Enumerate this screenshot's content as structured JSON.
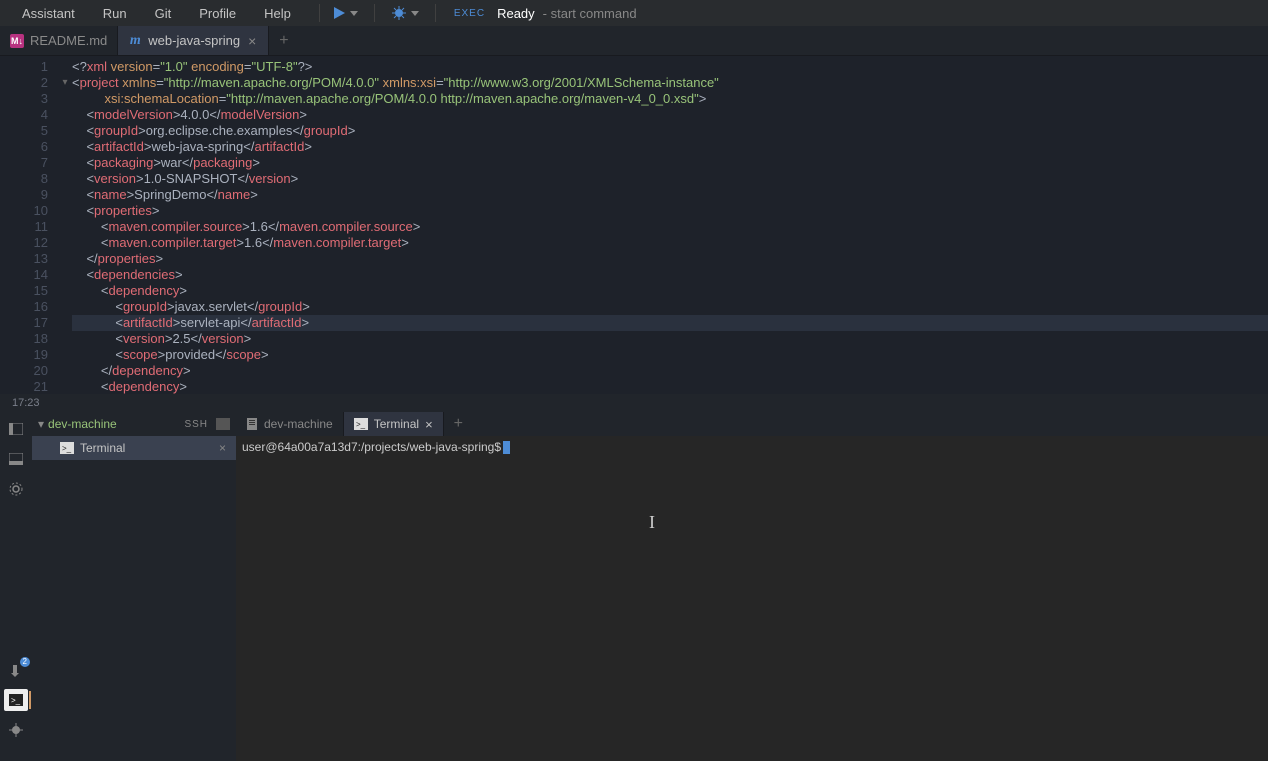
{
  "menu": {
    "items": [
      "Assistant",
      "Run",
      "Git",
      "Profile",
      "Help"
    ]
  },
  "toolbar": {
    "exec": "EXEC",
    "ready": "Ready",
    "hint": "- start command"
  },
  "editorTabs": [
    {
      "icon": "md",
      "label": "README.md",
      "active": false,
      "closable": false
    },
    {
      "icon": "mvn",
      "label": "web-java-spring",
      "active": true,
      "closable": true
    }
  ],
  "code": {
    "lines": [
      {
        "n": 1,
        "indent": 0,
        "tokens": [
          [
            "pi",
            "<?"
          ],
          [
            "tag",
            "xml"
          ],
          [
            "txt",
            " "
          ],
          [
            "attr",
            "version"
          ],
          [
            "punc",
            "="
          ],
          [
            "str",
            "\"1.0\""
          ],
          [
            "txt",
            " "
          ],
          [
            "attr",
            "encoding"
          ],
          [
            "punc",
            "="
          ],
          [
            "str",
            "\"UTF-8\""
          ],
          [
            "pi",
            "?>"
          ]
        ]
      },
      {
        "n": 2,
        "indent": 0,
        "fold": "▾",
        "tokens": [
          [
            "punc",
            "<"
          ],
          [
            "tag",
            "project"
          ],
          [
            "txt",
            " "
          ],
          [
            "attr",
            "xmlns"
          ],
          [
            "punc",
            "="
          ],
          [
            "str",
            "\"http://maven.apache.org/POM/4.0.0\""
          ],
          [
            "txt",
            " "
          ],
          [
            "attr",
            "xmlns:xsi"
          ],
          [
            "punc",
            "="
          ],
          [
            "str",
            "\"http://www.w3.org/2001/XMLSchema-instance\""
          ]
        ]
      },
      {
        "n": 3,
        "indent": 9,
        "tokens": [
          [
            "attr",
            "xsi:schemaLocation"
          ],
          [
            "punc",
            "="
          ],
          [
            "str",
            "\"http://maven.apache.org/POM/4.0.0 http://maven.apache.org/maven-v4_0_0.xsd\""
          ],
          [
            "punc",
            ">"
          ]
        ]
      },
      {
        "n": 4,
        "indent": 4,
        "tokens": [
          [
            "punc",
            "<"
          ],
          [
            "tag",
            "modelVersion"
          ],
          [
            "punc",
            ">"
          ],
          [
            "txt",
            "4.0.0"
          ],
          [
            "punc",
            "</"
          ],
          [
            "tag",
            "modelVersion"
          ],
          [
            "punc",
            ">"
          ]
        ]
      },
      {
        "n": 5,
        "indent": 4,
        "tokens": [
          [
            "punc",
            "<"
          ],
          [
            "tag",
            "groupId"
          ],
          [
            "punc",
            ">"
          ],
          [
            "txt",
            "org.eclipse.che.examples"
          ],
          [
            "punc",
            "</"
          ],
          [
            "tag",
            "groupId"
          ],
          [
            "punc",
            ">"
          ]
        ]
      },
      {
        "n": 6,
        "indent": 4,
        "tokens": [
          [
            "punc",
            "<"
          ],
          [
            "tag",
            "artifactId"
          ],
          [
            "punc",
            ">"
          ],
          [
            "txt",
            "web-java-spring"
          ],
          [
            "punc",
            "</"
          ],
          [
            "tag",
            "artifactId"
          ],
          [
            "punc",
            ">"
          ]
        ]
      },
      {
        "n": 7,
        "indent": 4,
        "tokens": [
          [
            "punc",
            "<"
          ],
          [
            "tag",
            "packaging"
          ],
          [
            "punc",
            ">"
          ],
          [
            "txt",
            "war"
          ],
          [
            "punc",
            "</"
          ],
          [
            "tag",
            "packaging"
          ],
          [
            "punc",
            ">"
          ]
        ]
      },
      {
        "n": 8,
        "indent": 4,
        "tokens": [
          [
            "punc",
            "<"
          ],
          [
            "tag",
            "version"
          ],
          [
            "punc",
            ">"
          ],
          [
            "txt",
            "1.0-SNAPSHOT"
          ],
          [
            "punc",
            "</"
          ],
          [
            "tag",
            "version"
          ],
          [
            "punc",
            ">"
          ]
        ]
      },
      {
        "n": 9,
        "indent": 4,
        "tokens": [
          [
            "punc",
            "<"
          ],
          [
            "tag",
            "name"
          ],
          [
            "punc",
            ">"
          ],
          [
            "txt",
            "SpringDemo"
          ],
          [
            "punc",
            "</"
          ],
          [
            "tag",
            "name"
          ],
          [
            "punc",
            ">"
          ]
        ]
      },
      {
        "n": 10,
        "indent": 4,
        "tokens": [
          [
            "punc",
            "<"
          ],
          [
            "tag",
            "properties"
          ],
          [
            "punc",
            ">"
          ]
        ]
      },
      {
        "n": 11,
        "indent": 8,
        "tokens": [
          [
            "punc",
            "<"
          ],
          [
            "tag",
            "maven.compiler.source"
          ],
          [
            "punc",
            ">"
          ],
          [
            "txt",
            "1.6"
          ],
          [
            "punc",
            "</"
          ],
          [
            "tag",
            "maven.compiler.source"
          ],
          [
            "punc",
            ">"
          ]
        ]
      },
      {
        "n": 12,
        "indent": 8,
        "tokens": [
          [
            "punc",
            "<"
          ],
          [
            "tag",
            "maven.compiler.target"
          ],
          [
            "punc",
            ">"
          ],
          [
            "txt",
            "1.6"
          ],
          [
            "punc",
            "</"
          ],
          [
            "tag",
            "maven.compiler.target"
          ],
          [
            "punc",
            ">"
          ]
        ]
      },
      {
        "n": 13,
        "indent": 4,
        "tokens": [
          [
            "punc",
            "</"
          ],
          [
            "tag",
            "properties"
          ],
          [
            "punc",
            ">"
          ]
        ]
      },
      {
        "n": 14,
        "indent": 4,
        "tokens": [
          [
            "punc",
            "<"
          ],
          [
            "tag",
            "dependencies"
          ],
          [
            "punc",
            ">"
          ]
        ]
      },
      {
        "n": 15,
        "indent": 8,
        "tokens": [
          [
            "punc",
            "<"
          ],
          [
            "tag",
            "dependency"
          ],
          [
            "punc",
            ">"
          ]
        ]
      },
      {
        "n": 16,
        "indent": 12,
        "tokens": [
          [
            "punc",
            "<"
          ],
          [
            "tag",
            "groupId"
          ],
          [
            "punc",
            ">"
          ],
          [
            "txt",
            "javax.servlet"
          ],
          [
            "punc",
            "</"
          ],
          [
            "tag",
            "groupId"
          ],
          [
            "punc",
            ">"
          ]
        ]
      },
      {
        "n": 17,
        "indent": 12,
        "hl": true,
        "tokens": [
          [
            "punc",
            "<"
          ],
          [
            "tag",
            "artifactId"
          ],
          [
            "punc",
            ">"
          ],
          [
            "txt",
            "servlet-api"
          ],
          [
            "punc",
            "</"
          ],
          [
            "tag",
            "artifactId"
          ],
          [
            "punc",
            ">"
          ]
        ]
      },
      {
        "n": 18,
        "indent": 12,
        "tokens": [
          [
            "punc",
            "<"
          ],
          [
            "tag",
            "version"
          ],
          [
            "punc",
            ">"
          ],
          [
            "txt",
            "2.5"
          ],
          [
            "punc",
            "</"
          ],
          [
            "tag",
            "version"
          ],
          [
            "punc",
            ">"
          ]
        ]
      },
      {
        "n": 19,
        "indent": 12,
        "tokens": [
          [
            "punc",
            "<"
          ],
          [
            "tag",
            "scope"
          ],
          [
            "punc",
            ">"
          ],
          [
            "txt",
            "provided"
          ],
          [
            "punc",
            "</"
          ],
          [
            "tag",
            "scope"
          ],
          [
            "punc",
            ">"
          ]
        ]
      },
      {
        "n": 20,
        "indent": 8,
        "tokens": [
          [
            "punc",
            "</"
          ],
          [
            "tag",
            "dependency"
          ],
          [
            "punc",
            ">"
          ]
        ]
      },
      {
        "n": 21,
        "indent": 8,
        "tokens": [
          [
            "punc",
            "<"
          ],
          [
            "tag",
            "dependency"
          ],
          [
            "punc",
            ">"
          ]
        ]
      }
    ]
  },
  "status": {
    "pos": "17:23"
  },
  "processes": {
    "machine": "dev-machine",
    "ssh": "SSH",
    "terminal": "Terminal"
  },
  "termTabs": [
    {
      "icon": "doc",
      "label": "dev-machine",
      "active": false,
      "closable": false
    },
    {
      "icon": "term",
      "label": "Terminal",
      "active": true,
      "closable": true
    }
  ],
  "terminal": {
    "prompt": "user@64a00a7a13d7:/projects/web-java-spring$"
  },
  "rail": {
    "badge": "2"
  }
}
